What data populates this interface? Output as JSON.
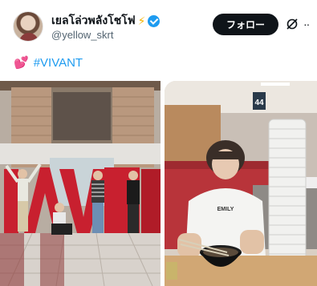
{
  "post": {
    "display_name": "เยลโล่วพลังโชโฟ",
    "name_emoji": "⚡",
    "handle": "@yellow_skrt",
    "follow_label": "フォロー",
    "text_emoji": "💕",
    "hashtag": "#VIVANT",
    "more_label": "··"
  },
  "icons": {
    "verified": "verified-badge-icon",
    "grok": "grok-icon",
    "more": "more-options-icon"
  },
  "media": {
    "left_sign_text": "VIVANT",
    "right_floor_sign": "44",
    "right_tshirt_text": "EMILY"
  },
  "colors": {
    "accent": "#1d9bf0",
    "button": "#0f1419",
    "sign_red": "#c8202f"
  }
}
